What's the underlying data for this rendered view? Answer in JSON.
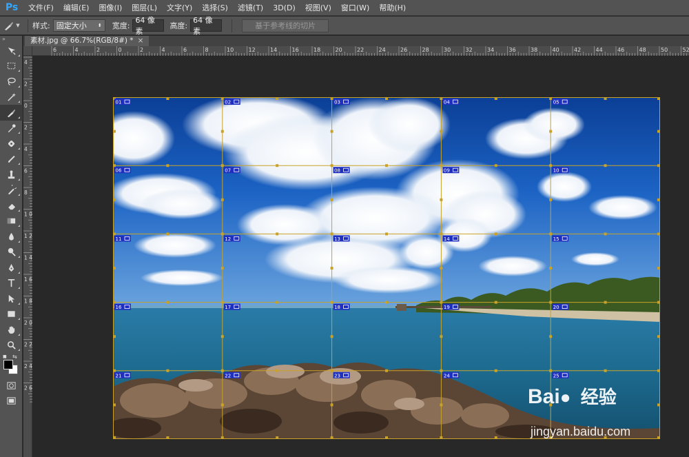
{
  "app": {
    "logo": "Ps"
  },
  "menu": [
    "文件(F)",
    "编辑(E)",
    "图像(I)",
    "图层(L)",
    "文字(Y)",
    "选择(S)",
    "滤镜(T)",
    "3D(D)",
    "视图(V)",
    "窗口(W)",
    "帮助(H)"
  ],
  "options": {
    "tool_icon": "slice-tool-icon",
    "style_label": "样式:",
    "style_value": "固定大小",
    "width_label": "宽度:",
    "width_value": "64 像素",
    "height_label": "高度:",
    "height_value": "64 像素",
    "guides_button": "基于参考线的切片"
  },
  "tools": [
    "move-tool-icon",
    "marquee-tool-icon",
    "lasso-tool-icon",
    "magic-wand-tool-icon",
    "slice-tool-icon",
    "eyedropper-tool-icon",
    "spot-healing-tool-icon",
    "brush-tool-icon",
    "clone-stamp-tool-icon",
    "history-brush-tool-icon",
    "eraser-tool-icon",
    "gradient-tool-icon",
    "blur-tool-icon",
    "dodge-tool-icon",
    "pen-tool-icon",
    "type-tool-icon",
    "path-selection-tool-icon",
    "rectangle-tool-icon",
    "hand-tool-icon",
    "zoom-tool-icon"
  ],
  "active_tool": "slice-tool-icon",
  "colors": {
    "foreground": "#000000",
    "background": "#ffffff",
    "slice_line": "#c9a227",
    "slice_badge": "#1f2fbf",
    "accent": "#31a8ff"
  },
  "document": {
    "tab_title": "素材.jpg @ 66.7%(RGB/8#) *",
    "close": "×"
  },
  "ruler_h_labels": [
    "6",
    "4",
    "2",
    "0",
    "2",
    "4",
    "6",
    "8",
    "10",
    "12",
    "14",
    "16",
    "18",
    "20",
    "22",
    "24",
    "26",
    "28",
    "30",
    "32",
    "34",
    "36",
    "38",
    "40",
    "42",
    "44",
    "46",
    "48",
    "50",
    "52"
  ],
  "ruler_v_labels": [
    "4",
    "2",
    "0",
    "2",
    "4",
    "6",
    "8",
    "1 0",
    "1 2",
    "1 4",
    "1 6",
    "1 8",
    "2 0",
    "2 2",
    "2 4",
    "2 6"
  ],
  "slices": [
    "01",
    "02",
    "03",
    "04",
    "05",
    "06",
    "07",
    "08",
    "09",
    "10",
    "11",
    "12",
    "13",
    "14",
    "15",
    "16",
    "17",
    "18",
    "19",
    "20",
    "21",
    "22",
    "23",
    "24",
    "25"
  ],
  "watermark": {
    "brand": "Bai",
    "brand2": "经验",
    "url": "jingyan.baidu.com"
  }
}
